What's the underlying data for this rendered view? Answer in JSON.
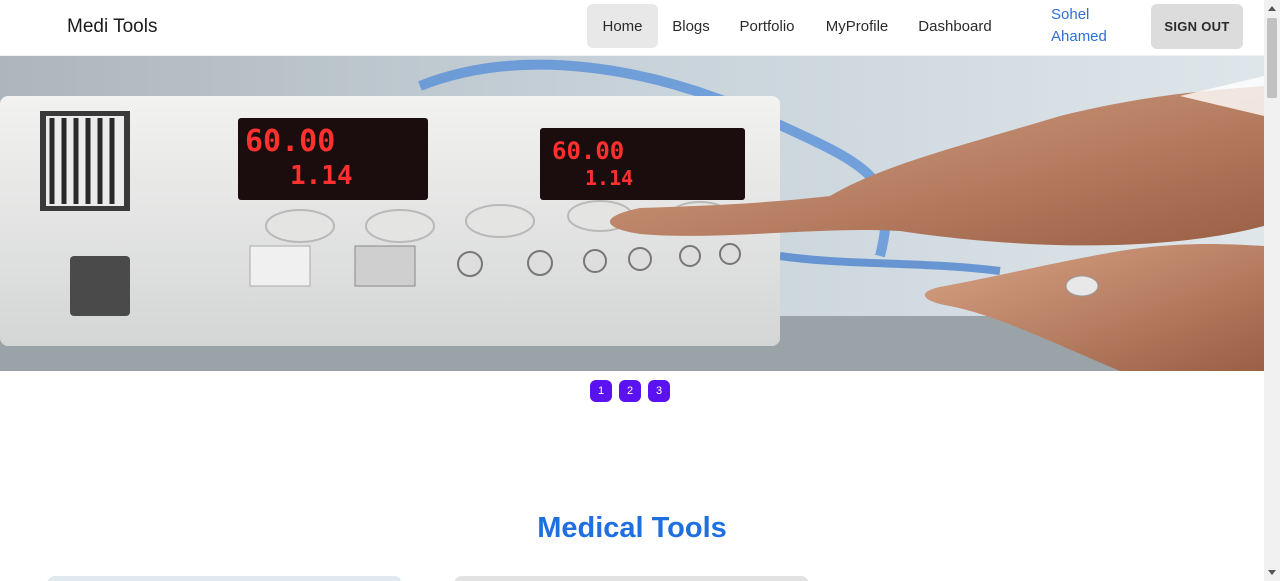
{
  "navbar": {
    "brand": "Medi Tools",
    "links": [
      {
        "label": "Home",
        "active": true
      },
      {
        "label": "Blogs",
        "active": false
      },
      {
        "label": "Portfolio",
        "active": false
      },
      {
        "label": "MyProfile",
        "active": false
      },
      {
        "label": "Dashboard",
        "active": false
      }
    ],
    "user_name": "Sohel Ahamed",
    "signout_label": "SIGN OUT"
  },
  "carousel": {
    "display_top": "60.00",
    "display_bottom": "1.14",
    "display_top_right": "60.00",
    "display_bottom_right": "1.14",
    "indicators": [
      "1",
      "2",
      "3"
    ]
  },
  "section": {
    "title": "Medical Tools"
  },
  "colors": {
    "accent_indicator": "#5b12f0",
    "title_blue": "#1f6fe0",
    "user_link": "#2f6fd6"
  }
}
